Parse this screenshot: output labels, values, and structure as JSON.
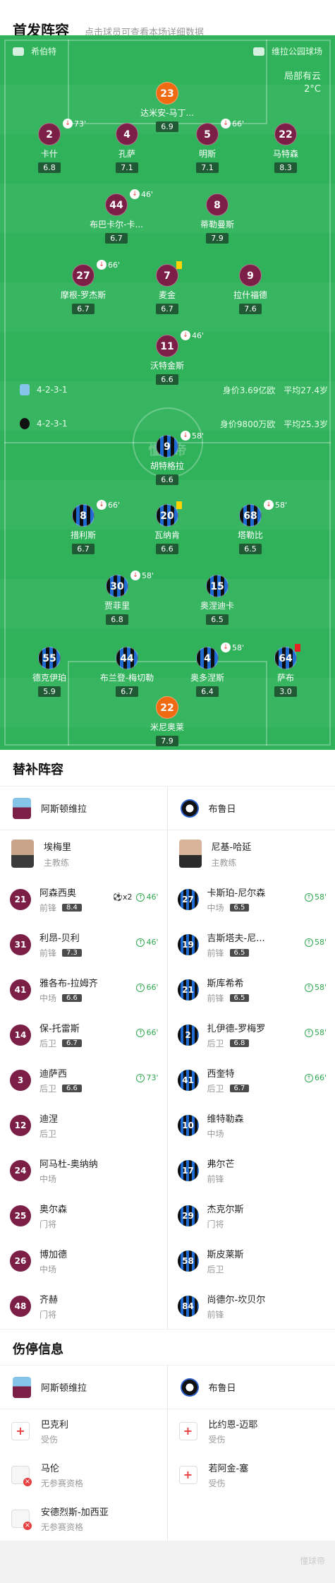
{
  "header": {
    "title": "首发阵容",
    "subtitle": "点击球员可查看本场详细数据"
  },
  "pitch": {
    "home_team": "希伯特",
    "venue": "维拉公园球场",
    "weather": "局部有云",
    "temperature": "2°C",
    "watermark": "懂球帝",
    "villa": {
      "formation": "4-2-3-1",
      "value": "身价3.69亿欧",
      "age": "平均27.4岁"
    },
    "brugge": {
      "formation": "4-2-3-1",
      "value": "身价9800万欧",
      "age": "平均25.3岁"
    },
    "players": [
      {
        "num": "23",
        "name": "达米安-马丁...",
        "rating": "6.9",
        "team": "gk-o"
      },
      {
        "num": "2",
        "name": "卡什",
        "rating": "6.8",
        "team": "villa",
        "sub": "73'"
      },
      {
        "num": "4",
        "name": "孔萨",
        "rating": "7.1",
        "team": "villa"
      },
      {
        "num": "5",
        "name": "明斯",
        "rating": "7.1",
        "team": "villa",
        "sub": "66'"
      },
      {
        "num": "22",
        "name": "马特森",
        "rating": "8.3",
        "team": "villa"
      },
      {
        "num": "44",
        "name": "布巴卡尔-卡...",
        "rating": "6.7",
        "team": "villa",
        "sub": "46'"
      },
      {
        "num": "8",
        "name": "蒂勒曼斯",
        "rating": "7.9",
        "team": "villa"
      },
      {
        "num": "27",
        "name": "摩根-罗杰斯",
        "rating": "6.7",
        "team": "villa",
        "sub": "66'"
      },
      {
        "num": "7",
        "name": "麦金",
        "rating": "6.7",
        "team": "villa",
        "card": "yellow"
      },
      {
        "num": "9",
        "name": "拉什福德",
        "rating": "7.6",
        "team": "villa"
      },
      {
        "num": "11",
        "name": "沃特金斯",
        "rating": "6.6",
        "team": "villa",
        "sub": "46'"
      },
      {
        "num": "9",
        "name": "胡特格拉",
        "rating": "6.6",
        "team": "brugge",
        "sub": "58'"
      },
      {
        "num": "8",
        "name": "措利斯",
        "rating": "6.7",
        "team": "brugge",
        "sub": "66'"
      },
      {
        "num": "20",
        "name": "瓦纳肯",
        "rating": "6.6",
        "team": "brugge",
        "card": "yellow"
      },
      {
        "num": "68",
        "name": "塔勒比",
        "rating": "6.5",
        "team": "brugge",
        "sub": "58'"
      },
      {
        "num": "30",
        "name": "贾菲里",
        "rating": "6.8",
        "team": "brugge",
        "sub": "58'"
      },
      {
        "num": "15",
        "name": "奥涅迪卡",
        "rating": "6.5",
        "team": "brugge"
      },
      {
        "num": "55",
        "name": "德克伊珀",
        "rating": "5.9",
        "team": "brugge"
      },
      {
        "num": "44",
        "name": "布兰登-梅切勒",
        "rating": "6.7",
        "team": "brugge"
      },
      {
        "num": "4",
        "name": "奥多涅斯",
        "rating": "6.4",
        "team": "brugge",
        "sub": "58'"
      },
      {
        "num": "64",
        "name": "萨布",
        "rating": "3.0",
        "team": "brugge",
        "card": "red"
      },
      {
        "num": "22",
        "name": "米尼奥莱",
        "rating": "7.9",
        "team": "gk-o"
      }
    ]
  },
  "subs": {
    "title": "替补阵容",
    "villa": {
      "team": "阿斯顿维拉",
      "coach": {
        "name": "埃梅里",
        "role": "主教练"
      },
      "players": [
        {
          "num": "21",
          "name": "阿森西奥",
          "pos": "前锋",
          "rating": "8.4",
          "goals": "⚽x2",
          "in": "46'"
        },
        {
          "num": "31",
          "name": "利昂-贝利",
          "pos": "前锋",
          "rating": "7.3",
          "in": "46'"
        },
        {
          "num": "41",
          "name": "雅各布-拉姆齐",
          "pos": "中场",
          "rating": "6.6",
          "in": "66'"
        },
        {
          "num": "14",
          "name": "保-托雷斯",
          "pos": "后卫",
          "rating": "6.7",
          "in": "66'"
        },
        {
          "num": "3",
          "name": "迪萨西",
          "pos": "后卫",
          "rating": "6.6",
          "in": "73'"
        },
        {
          "num": "12",
          "name": "迪涅",
          "pos": "后卫"
        },
        {
          "num": "24",
          "name": "阿马杜-奥纳纳",
          "pos": "中场"
        },
        {
          "num": "25",
          "name": "奥尔森",
          "pos": "门将"
        },
        {
          "num": "26",
          "name": "博加德",
          "pos": "中场"
        },
        {
          "num": "48",
          "name": "齐赫",
          "pos": "门将"
        }
      ]
    },
    "brugge": {
      "team": "布鲁日",
      "coach": {
        "name": "尼基-哈延",
        "role": "主教练"
      },
      "players": [
        {
          "num": "27",
          "name": "卡斯珀-尼尔森",
          "pos": "中场",
          "rating": "6.5",
          "in": "58'"
        },
        {
          "num": "19",
          "name": "吉斯塔夫-尼...",
          "pos": "前锋",
          "rating": "6.5",
          "in": "58'"
        },
        {
          "num": "21",
          "name": "斯库希希",
          "pos": "前锋",
          "rating": "6.5",
          "in": "58'"
        },
        {
          "num": "2",
          "name": "扎伊德-罗梅罗",
          "pos": "后卫",
          "rating": "6.8",
          "in": "58'"
        },
        {
          "num": "41",
          "name": "西奎特",
          "pos": "后卫",
          "rating": "6.7",
          "in": "66'"
        },
        {
          "num": "10",
          "name": "维特勒森",
          "pos": "中场"
        },
        {
          "num": "17",
          "name": "弗尔芒",
          "pos": "前锋"
        },
        {
          "num": "29",
          "name": "杰克尔斯",
          "pos": "门将"
        },
        {
          "num": "58",
          "name": "斯皮莱斯",
          "pos": "后卫"
        },
        {
          "num": "84",
          "name": "尚德尔-坎贝尔",
          "pos": "前锋"
        }
      ]
    }
  },
  "injuries": {
    "title": "伤停信息",
    "villa": {
      "team": "阿斯顿维拉",
      "players": [
        {
          "name": "巴克利",
          "status": "受伤",
          "type": "hurt"
        },
        {
          "name": "马伦",
          "status": "无参赛资格",
          "type": "susp"
        },
        {
          "name": "安德烈斯-加西亚",
          "status": "无参赛资格",
          "type": "susp"
        }
      ]
    },
    "brugge": {
      "team": "布鲁日",
      "players": [
        {
          "name": "比约恩-迈耶",
          "status": "受伤",
          "type": "hurt"
        },
        {
          "name": "若阿金-塞",
          "status": "受伤",
          "type": "hurt"
        }
      ]
    }
  },
  "colors": {
    "pitch": "#2fb25a",
    "villa": "#7b1f47",
    "brugge_blue": "#1f6bd1",
    "gk": "#f06a12",
    "sub_green": "#2fa84f",
    "yellow_card": "#ffd400",
    "red_card": "#e62222"
  },
  "footer": {
    "watermark": "懂球帝"
  }
}
